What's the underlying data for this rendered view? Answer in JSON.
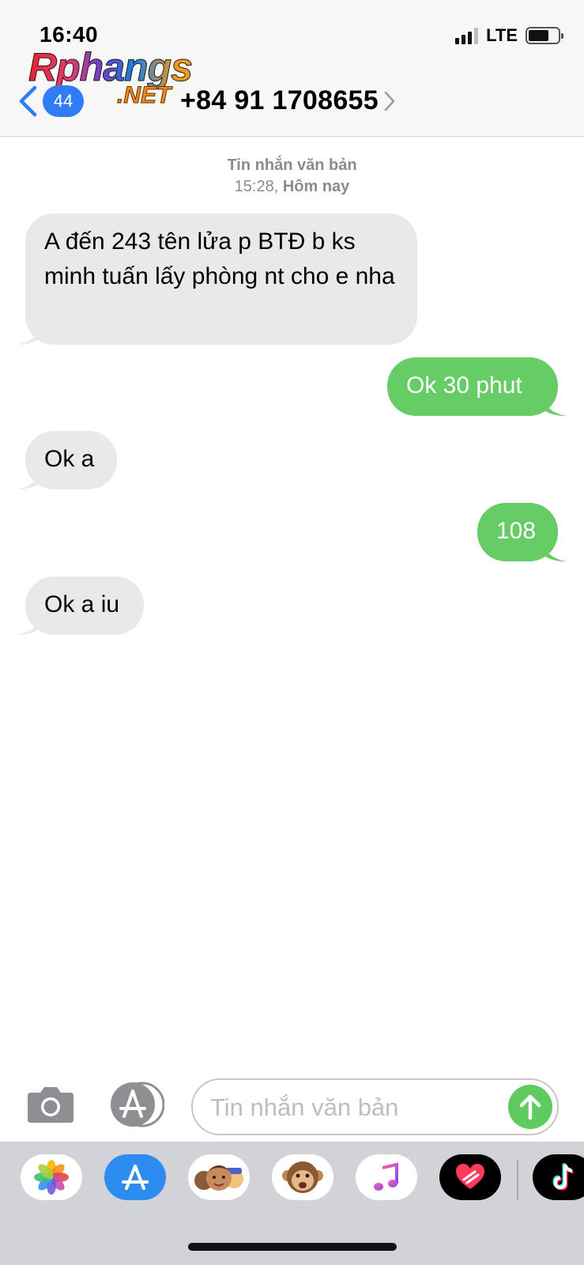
{
  "status_bar": {
    "time": "16:40",
    "network": "LTE",
    "battery_level": 0.7
  },
  "watermark": {
    "brand_main": "Rphangs",
    "brand_sub": ".NET"
  },
  "header": {
    "unread_count": "44",
    "contact": "+84 91 1708655"
  },
  "thread": {
    "type_label": "Tin nhắn văn bản",
    "time": "15:28,",
    "day": "Hôm nay"
  },
  "messages": [
    {
      "direction": "incoming",
      "text": "A đến 243 tên lửa p BTĐ b ks minh tuấn lấy phòng nt cho e nha"
    },
    {
      "direction": "outgoing",
      "text": "Ok 30 phut"
    },
    {
      "direction": "incoming",
      "text": "Ok a"
    },
    {
      "direction": "outgoing",
      "text": "108"
    },
    {
      "direction": "incoming",
      "text": "Ok a iu"
    }
  ],
  "composer": {
    "placeholder": "Tin nhắn văn bản",
    "value": ""
  },
  "colors": {
    "incoming_bubble": "#e9e9eb",
    "outgoing_bubble": "#66cd66",
    "badge": "#2f7cf6",
    "send": "#5fcb5f"
  },
  "app_drawer": {
    "apps": [
      "photos-app",
      "app-store-app",
      "memoji-app",
      "animoji-app",
      "music-app",
      "digital-touch-app",
      "tiktok-app"
    ]
  }
}
